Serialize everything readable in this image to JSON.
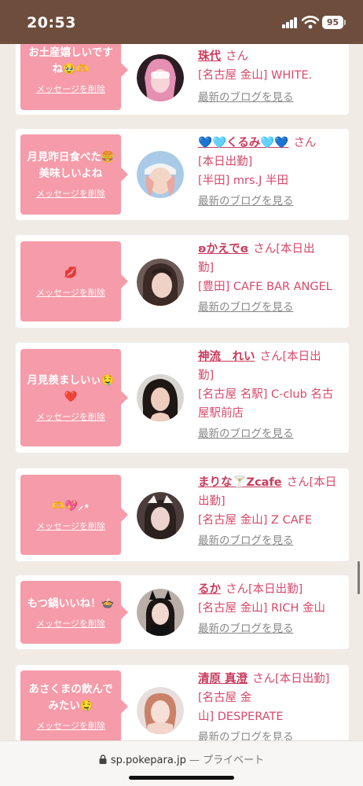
{
  "status_bar": {
    "time": "20:53",
    "battery": "95"
  },
  "cards": [
    {
      "message": "お土産嬉しいですね🥹🫶",
      "delete_label": "メッセージを削除",
      "name": "珠代",
      "san": "さん",
      "lines": [
        "[名古屋 金山] WHITE."
      ],
      "blog_link": "最新のブログを見る",
      "avatar_icon": "profile-photo"
    },
    {
      "message": "月見昨日食べた🍔美味しいよね",
      "delete_label": "メッセージを削除",
      "name": "💙🩵くるみ🩵💙",
      "san": "さん",
      "lines": [
        "[本日出勤]",
        "[半田] mrs.J 半田"
      ],
      "blog_link": "最新のブログを見る",
      "avatar_icon": "profile-photo"
    },
    {
      "message": "💋",
      "delete_label": "メッセージを削除",
      "name": "ʚかえでɞ",
      "san": "さん[本日出",
      "lines": [
        "勤]",
        "[豊田] CAFE BAR ANGEL"
      ],
      "blog_link": "最新のブログを見る",
      "avatar_icon": "profile-photo"
    },
    {
      "message": "月見羨ましいぃ🤤❤️",
      "delete_label": "メッセージを削除",
      "name": "神流　れい",
      "san": "さん[本日出",
      "lines": [
        "勤]",
        "[名古屋 名駅] C-club 名古",
        "屋駅前店"
      ],
      "blog_link": "最新のブログを見る",
      "avatar_icon": "profile-photo"
    },
    {
      "message": "🫶💖⸝⋆",
      "delete_label": "メッセージを削除",
      "name": "まりな🍸Zcafe",
      "san": "さん[本日",
      "lines": [
        "出勤]",
        "[名古屋 金山] Z CAFE"
      ],
      "blog_link": "最新のブログを見る",
      "avatar_icon": "profile-photo"
    },
    {
      "message": "もつ鍋いいね！🍲",
      "delete_label": "メッセージを削除",
      "name": "るか",
      "san": "さん[本日出勤]",
      "lines": [
        "[名古屋 金山] RICH 金山"
      ],
      "blog_link": "最新のブログを見る",
      "avatar_icon": "profile-photo"
    },
    {
      "message": "あさくまの飲んでみたい🤤",
      "delete_label": "メッセージを削除",
      "name": "清原 真澄",
      "san": "さん[本日出勤]",
      "lines": [
        "[名古屋 金",
        "山] DESPERATE"
      ],
      "blog_link": "最新のブログを見る",
      "avatar_icon": "profile-photo"
    }
  ],
  "browser": {
    "domain": "sp.pokepara.jp",
    "private_label": "— プライベート"
  },
  "colors": {
    "bubble": "#f59ba9",
    "name": "#c93a5c",
    "header": "#6e4d3d"
  }
}
